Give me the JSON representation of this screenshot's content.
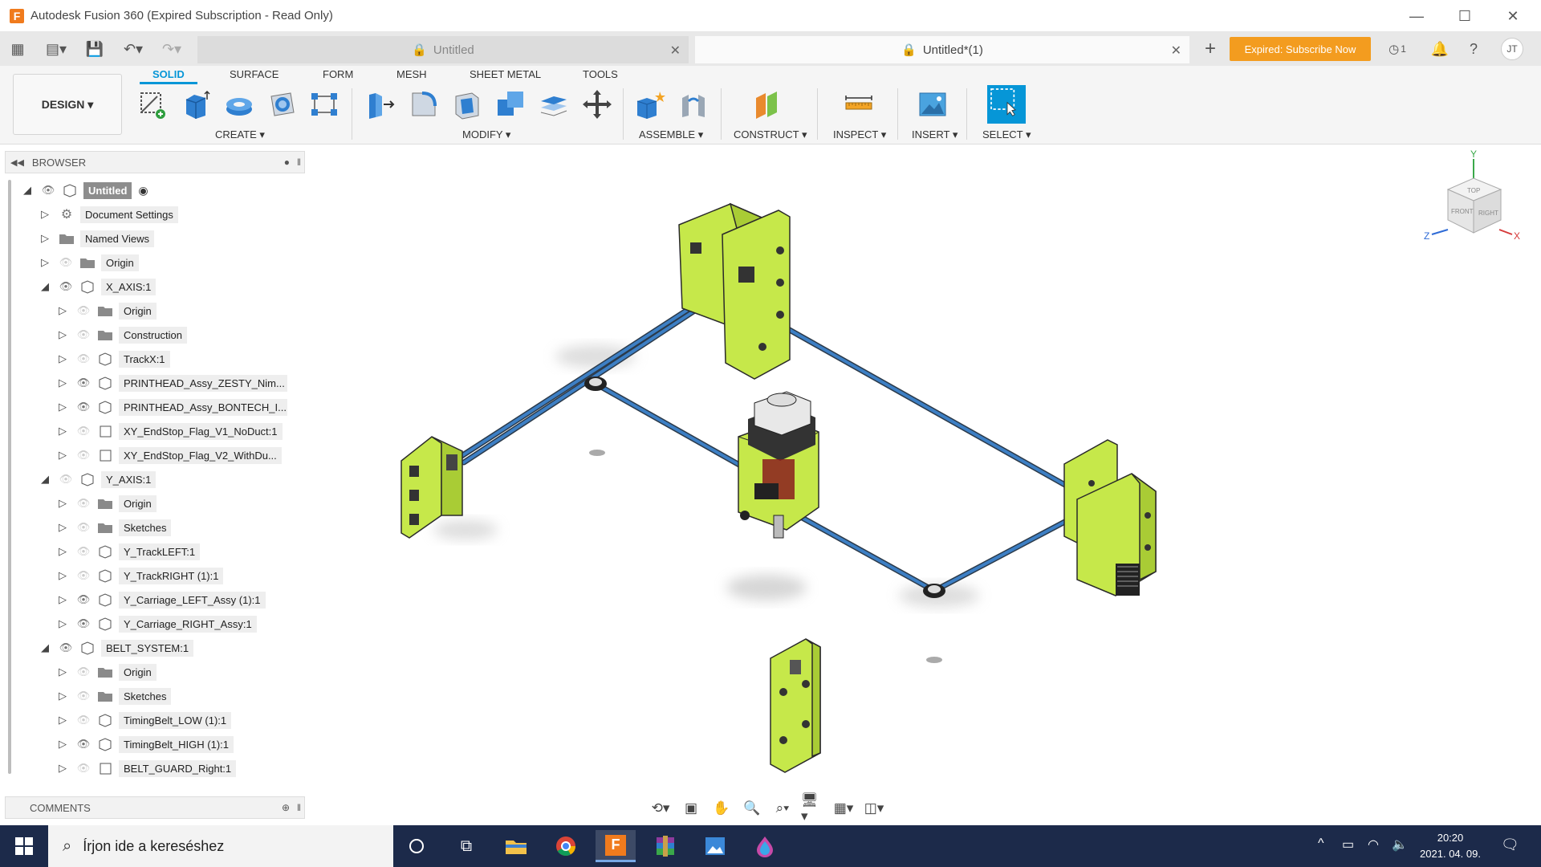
{
  "window": {
    "title": "Autodesk Fusion 360 (Expired Subscription - Read Only)",
    "logo_letter": "F"
  },
  "tabs": [
    {
      "label": "Untitled"
    },
    {
      "label": "Untitled*(1)"
    }
  ],
  "qat": {
    "subscribe_label": "Expired: Subscribe Now",
    "jobs_count": "1",
    "user_initials": "JT"
  },
  "ribbon": {
    "workspace_label": "DESIGN ▾",
    "tabs": [
      "SOLID",
      "SURFACE",
      "FORM",
      "MESH",
      "SHEET METAL",
      "TOOLS"
    ],
    "groups": {
      "create": "CREATE ▾",
      "modify": "MODIFY ▾",
      "assemble": "ASSEMBLE ▾",
      "construct": "CONSTRUCT ▾",
      "inspect": "INSPECT ▾",
      "insert": "INSERT ▾",
      "select": "SELECT ▾"
    }
  },
  "browser": {
    "title": "BROWSER",
    "items": [
      {
        "label": "Untitled"
      },
      {
        "label": "Document Settings"
      },
      {
        "label": "Named Views"
      },
      {
        "label": "Origin"
      },
      {
        "label": "X_AXIS:1"
      },
      {
        "label": "Origin"
      },
      {
        "label": "Construction"
      },
      {
        "label": "TrackX:1"
      },
      {
        "label": "PRINTHEAD_Assy_ZESTY_Nim..."
      },
      {
        "label": "PRINTHEAD_Assy_BONTECH_I..."
      },
      {
        "label": "XY_EndStop_Flag_V1_NoDuct:1"
      },
      {
        "label": "XY_EndStop_Flag_V2_WithDu..."
      },
      {
        "label": "Y_AXIS:1"
      },
      {
        "label": "Origin"
      },
      {
        "label": "Sketches"
      },
      {
        "label": "Y_TrackLEFT:1"
      },
      {
        "label": "Y_TrackRIGHT (1):1"
      },
      {
        "label": "Y_Carriage_LEFT_Assy (1):1"
      },
      {
        "label": "Y_Carriage_RIGHT_Assy:1"
      },
      {
        "label": "BELT_SYSTEM:1"
      },
      {
        "label": "Origin"
      },
      {
        "label": "Sketches"
      },
      {
        "label": "TimingBelt_LOW (1):1"
      },
      {
        "label": "TimingBelt_HIGH (1):1"
      },
      {
        "label": "BELT_GUARD_Right:1"
      }
    ]
  },
  "comments": {
    "title": "COMMENTS"
  },
  "viewcube": {
    "top": "TOP",
    "front": "FRONT",
    "right": "RIGHT",
    "axis_x": "X",
    "axis_y": "Y",
    "axis_z": "Z"
  },
  "taskbar": {
    "search_placeholder": "Írjon ide a kereséshez",
    "time": "20:20",
    "date": "2021. 04. 09."
  },
  "colors": {
    "part": "#c6e84a",
    "accent": "#0696d7",
    "subscribe": "#f39c1f",
    "belt": "#2b6cb0"
  }
}
